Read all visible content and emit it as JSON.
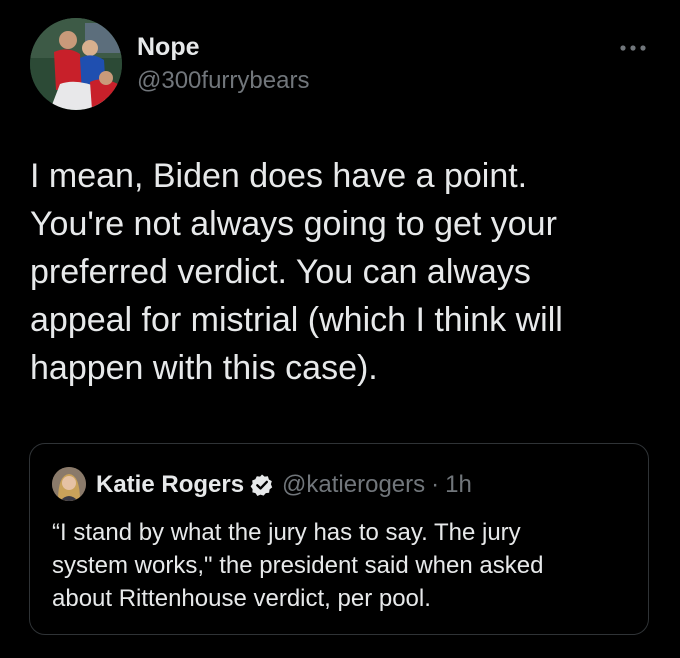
{
  "tweet": {
    "author_name": "Nope",
    "author_handle": "@300furrybears",
    "avatar_icon": "soccer-players-photo",
    "more_icon": "more-horizontal-icon",
    "text_lines": [
      "I mean, Biden does have a point.",
      "You're not always going to get your",
      "preferred verdict. You can always",
      "appeal for mistrial (which I think will",
      "happen with this case)."
    ]
  },
  "quote": {
    "author_name": "Katie Rogers",
    "author_handle": "@katierogers",
    "separator": "·",
    "time": "1h",
    "verified_icon": "verified-badge-icon",
    "text_lines": [
      "“I stand by what the jury has to say. The jury",
      "system works,\" the president said when asked",
      "about Rittenhouse verdict, per pool."
    ]
  },
  "colors": {
    "background": "#000000",
    "primary_text": "#e7e9ea",
    "secondary_text": "#71767b",
    "border": "#2f3336"
  }
}
